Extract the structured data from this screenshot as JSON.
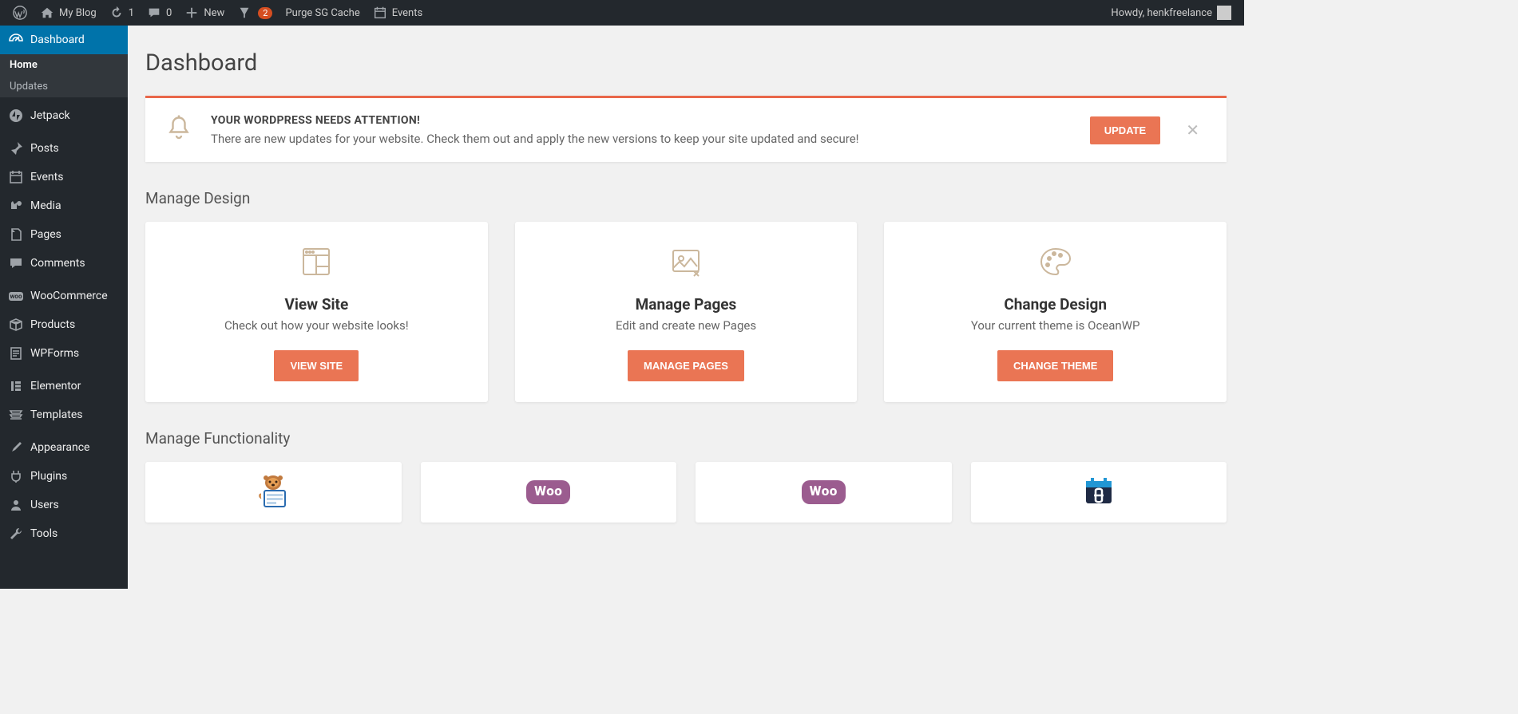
{
  "adminbar": {
    "site_name": "My Blog",
    "updates_count": "1",
    "comments_count": "0",
    "new_label": "New",
    "yoast_count": "2",
    "purge_label": "Purge SG Cache",
    "events_label": "Events",
    "howdy": "Howdy, henkfreelance"
  },
  "sidebar": {
    "dashboard": "Dashboard",
    "home": "Home",
    "updates": "Updates",
    "jetpack": "Jetpack",
    "posts": "Posts",
    "events": "Events",
    "media": "Media",
    "pages": "Pages",
    "comments": "Comments",
    "woocommerce": "WooCommerce",
    "products": "Products",
    "wpforms": "WPForms",
    "elementor": "Elementor",
    "templates": "Templates",
    "appearance": "Appearance",
    "plugins": "Plugins",
    "users": "Users",
    "tools": "Tools"
  },
  "page": {
    "title": "Dashboard"
  },
  "notice": {
    "heading": "YOUR WORDPRESS NEEDS ATTENTION!",
    "body": "There are new updates for your website. Check them out and apply the new versions to keep your site updated and secure!",
    "button": "UPDATE"
  },
  "design_section": {
    "title": "Manage Design",
    "cards": [
      {
        "title": "View Site",
        "desc": "Check out how your website looks!",
        "button": "VIEW SITE"
      },
      {
        "title": "Manage Pages",
        "desc": "Edit and create new Pages",
        "button": "MANAGE PAGES"
      },
      {
        "title": "Change Design",
        "desc": "Your current theme is OceanWP",
        "button": "CHANGE THEME"
      }
    ]
  },
  "func_section": {
    "title": "Manage Functionality"
  }
}
